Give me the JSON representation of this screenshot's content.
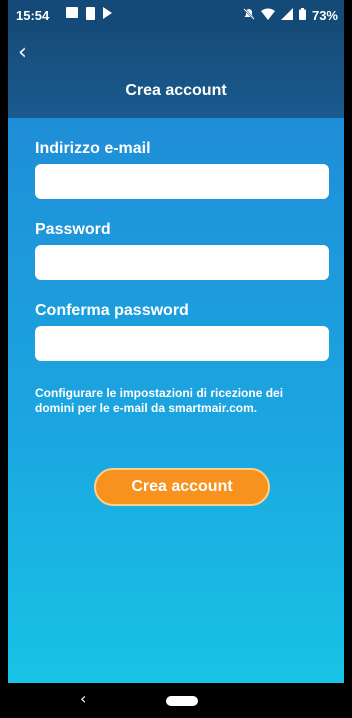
{
  "status_bar": {
    "time": "15:54",
    "battery": "73%",
    "icons": [
      "image-icon",
      "phone-icon",
      "play-icon",
      "mute-icon",
      "wifi-icon",
      "signal-icon",
      "battery-icon"
    ]
  },
  "header": {
    "back_icon": "chevron-left-icon",
    "title": "Crea account"
  },
  "form": {
    "email_label": "Indirizzo e-mail",
    "email_value": "",
    "password_label": "Password",
    "password_value": "",
    "confirm_label": "Conferma password",
    "confirm_value": "",
    "note": "Configurare le impostazioni di ricezione dei domini per le e-mail da smartmair.com.",
    "submit_label": "Crea account"
  },
  "nav": {
    "back_icon": "nav-back-icon",
    "home_icon": "home-pill-icon"
  },
  "colors": {
    "header": "#164d7a",
    "accent": "#f7921e",
    "gradient_top": "#1f8ed8",
    "gradient_bottom": "#18c3e6"
  }
}
